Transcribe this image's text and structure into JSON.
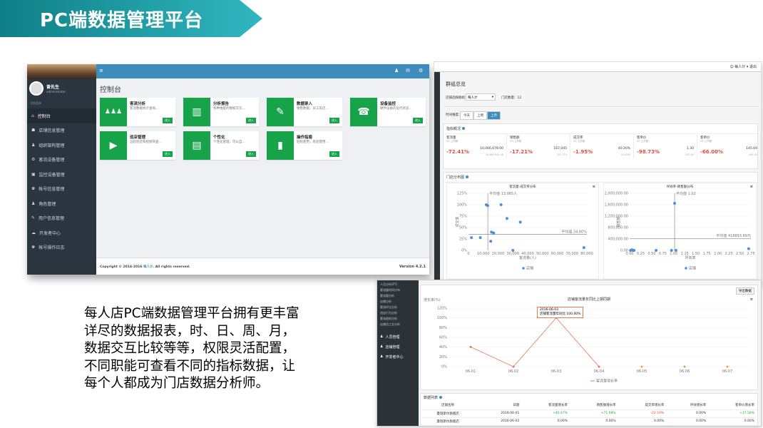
{
  "banner": {
    "title": "PC端数据管理平台"
  },
  "description": "每人店PC端数据管理平台拥有更丰富详尽的数据报表，时、日、周、月，数据交互比较等等，权限灵活配置，不同职能可查看不同的指标数据，让每个人都成为门店数据分析师。",
  "console": {
    "user": {
      "name": "曾先生",
      "role": "administrator"
    },
    "sidebar_header": "导航菜单",
    "menu": [
      {
        "label": "控制台",
        "icon": "⌂"
      },
      {
        "label": "店铺信息管理",
        "icon": "☗"
      },
      {
        "label": "组织架构管理",
        "icon": "♟"
      },
      {
        "label": "客流设备管理",
        "icon": "⚙"
      },
      {
        "label": "监控设备管理",
        "icon": "▣"
      },
      {
        "label": "帐号信息管理",
        "icon": "♚"
      },
      {
        "label": "角色管理",
        "icon": "♟"
      },
      {
        "label": "用户信息管理",
        "icon": "✎"
      },
      {
        "label": "开发者中心",
        "icon": "☁"
      },
      {
        "label": "帐号操作日志",
        "icon": "♚"
      }
    ],
    "page_title": "控制台",
    "cards": [
      {
        "title": "客流分析",
        "desc": "客流数据统计查询...",
        "btn": "进入",
        "icon": "♟♟♟"
      },
      {
        "title": "分析报告",
        "desc": "各种维度的数据交叉...",
        "btn": "进入",
        "icon": "▥"
      },
      {
        "title": "数据录入",
        "desc": "销售数据、员工及店...",
        "btn": "进入",
        "icon": "✎"
      },
      {
        "title": "设备监控",
        "desc": "硬件设备的运行状态...",
        "btn": "进入",
        "icon": "☎"
      },
      {
        "title": "巡店管理",
        "desc": "远程巡店和视频筛查...",
        "btn": "进入",
        "icon": "▶"
      },
      {
        "title": "个性化",
        "desc": "个性化管理、可以自...",
        "btn": "进入",
        "icon": "▤"
      },
      {
        "title": "操作指南",
        "desc": "轻松使用，悉迎使用...",
        "btn": "进入",
        "icon": "▮"
      }
    ],
    "footer": {
      "copyright": "Copyright © 2014-2016",
      "brand": "每人计",
      "rights": ". All rights reserved.",
      "version": "Version 4.2.1"
    }
  },
  "overview": {
    "title": "群组总览",
    "store_label": "店铺选择群组：",
    "store_value": "每人计",
    "store_count": "门店数量：12",
    "time_label": "时间维度：",
    "time_tabs": [
      "今天",
      "上周",
      "上月"
    ],
    "kpi_header": "指标概况",
    "kpis": [
      {
        "title": "客流量",
        "sub": "VS 上同期",
        "pct": "-72.41%",
        "v1": "10,066,678.00",
        "v2": "36,488,945.00"
      },
      {
        "title": "销售额",
        "sub": "VS 上同期",
        "pct": "-17.21%",
        "v1": "167,045",
        "v2": "201,774"
      },
      {
        "title": "成交率",
        "sub": "VS 上同期",
        "pct": "-1.95%",
        "v1": "40.20%",
        "v2": "41.00%"
      },
      {
        "title": "客单价",
        "sub": "VS 上同期",
        "pct": "-98.73%",
        "v1": "1.30",
        "v2": "102.40"
      },
      {
        "title": "客单价",
        "sub": "VS 上同期",
        "pct": "-66.00%",
        "v1": "145.69",
        "v2": "445.00"
      }
    ],
    "scatter_header": "门店分布图",
    "scatter1": {
      "title": "客流量-成交率分布",
      "xlabel": "客流量(人)",
      "ylabel": "成交率",
      "legend": "店铺",
      "avg_x": "平均值 13,065人",
      "avg_y": "平均值 34.80%"
    },
    "scatter2": {
      "title": "坪效率-销售额分布",
      "xlabel": "坪效率",
      "ylabel": "销售额",
      "legend": "店铺",
      "avg_x": "平均值 1.02",
      "avg_y": "平均值 418893.69元"
    }
  },
  "trend": {
    "side_items": [
      "人员分析(PT)",
      "客流量时间分布",
      "客流量分析",
      "店铺分析",
      "客流环比分析",
      "进店行为分析",
      "客流趋势分析",
      "店铺员工业分析"
    ],
    "side_menu": [
      "人员管理",
      "店铺管理",
      "开发者中心"
    ],
    "chart_title": "店铺客流量年同比上期同期",
    "export_btn": "导出数据",
    "tooltip_date": "2016-06-03",
    "tooltip_value": "店铺客流量年同比 100.00%",
    "ylabel": "增长率(%)",
    "legend": "客流量增长率",
    "table_header": "数据列表",
    "columns": [
      "店铺名称",
      "日期",
      "客流量增长率",
      "销售额增长率",
      "成交率增长率",
      "坪效增长率",
      "客单价增长率"
    ],
    "rows": [
      [
        "曼瑞斯尔旗舰店",
        "2016-06-01",
        "+40.47%",
        "+71.08%",
        "-22.16%",
        "0.00%",
        "+37.58%"
      ],
      [
        "曼瑞斯尔旗舰店",
        "2016-06-02",
        "0.00%",
        "0.00%",
        "0.00%",
        "0.00%",
        "0.00%"
      ]
    ]
  },
  "chart_data": [
    {
      "type": "scatter",
      "title": "客流量-成交率分布",
      "xlabel": "客流量(人)",
      "ylabel": "成交率",
      "ylim": [
        0,
        125
      ],
      "x_ticks": [
        "0",
        "10,000",
        "20,000",
        "30,000",
        "40,000",
        "50,000",
        "60,000",
        "70,000",
        "80,000"
      ],
      "y_ticks": [
        "0%",
        "25%",
        "50%",
        "75%",
        "100%",
        "125%"
      ],
      "series": [
        {
          "name": "店铺",
          "points": [
            [
              2000,
              28
            ],
            [
              8000,
              28
            ],
            [
              12000,
              100
            ],
            [
              13000,
              98
            ],
            [
              15000,
              20
            ],
            [
              15500,
              40
            ],
            [
              17000,
              38
            ],
            [
              22000,
              100
            ],
            [
              26000,
              70
            ],
            [
              30000,
              0
            ],
            [
              35000,
              62
            ],
            [
              78000,
              6
            ]
          ]
        }
      ]
    },
    {
      "type": "scatter",
      "title": "坪效率-销售额分布",
      "xlabel": "坪效率",
      "ylabel": "销售额",
      "ylim": [
        0,
        2000000
      ],
      "x_ticks": [
        "0.00",
        "0.25",
        "0.50",
        "0.75",
        "1.00",
        "1.25",
        "1.50",
        "1.75",
        "2.00",
        "2.25",
        "2.50",
        "2.75"
      ],
      "y_ticks": [
        "0.00",
        "400,000.00",
        "800,000.00",
        "1,200,000.00",
        "1,600,000.00",
        "2,000,000.00"
      ],
      "series": [
        {
          "name": "店铺",
          "points": [
            [
              0.02,
              0
            ],
            [
              0.08,
              0
            ],
            [
              0.05,
              20000
            ],
            [
              0.1,
              0
            ],
            [
              0.6,
              0
            ],
            [
              0.95,
              0
            ],
            [
              1.02,
              1650000
            ],
            [
              1.05,
              0
            ],
            [
              2.7,
              60000
            ]
          ]
        }
      ]
    },
    {
      "type": "line",
      "title": "店铺客流量年同比上期同期",
      "ylabel": "增长率(%)",
      "categories": [
        "06-01",
        "06-02",
        "06-03",
        "06-04",
        "06-05",
        "06-06",
        "06-07"
      ],
      "y_ticks": [
        "0%",
        "20%",
        "40%",
        "60%",
        "80%",
        "100%",
        "120%"
      ],
      "series": [
        {
          "name": "客流量增长率",
          "values": [
            40.47,
            0,
            100,
            0,
            0,
            0,
            0
          ]
        }
      ]
    }
  ]
}
